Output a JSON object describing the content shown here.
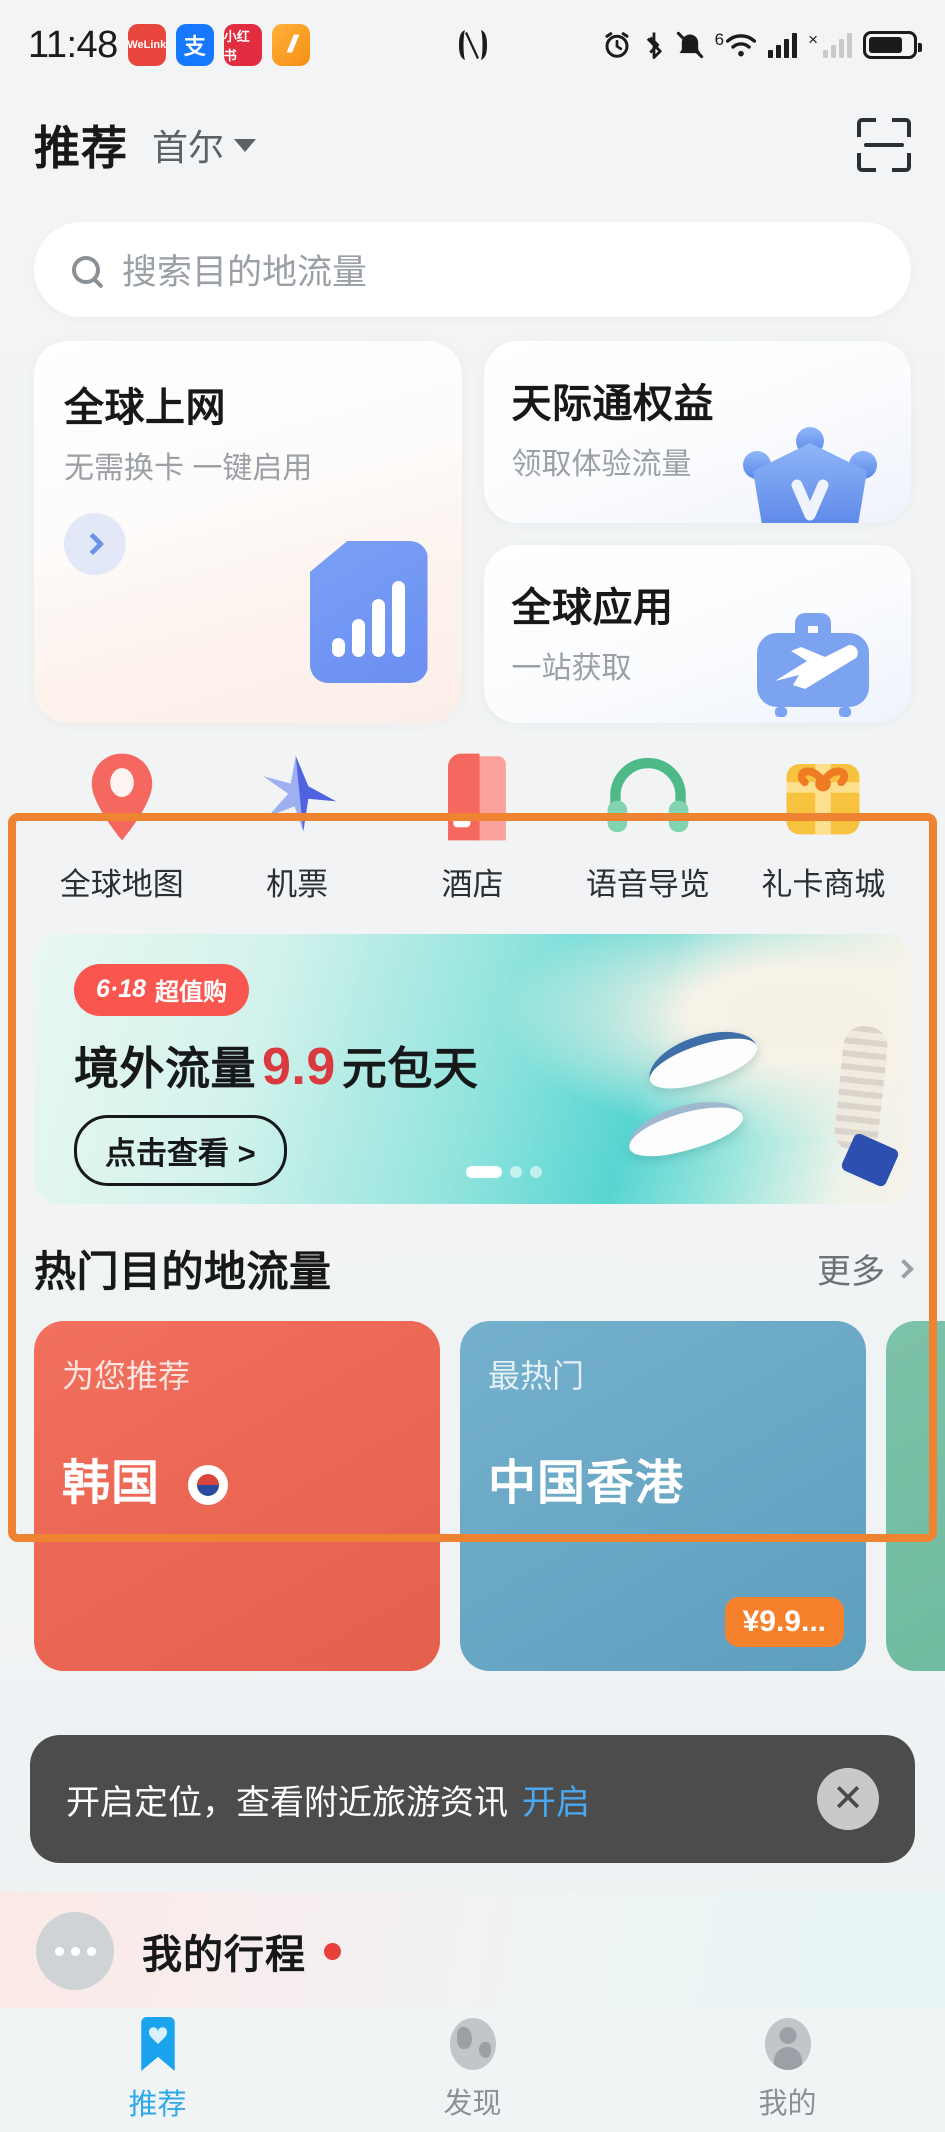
{
  "status_bar": {
    "time": "11:48",
    "apps": [
      {
        "name": "welink-app-icon",
        "label": "WeLink"
      },
      {
        "name": "alipay-app-icon",
        "label": "支"
      },
      {
        "name": "xiaohongshu-app-icon",
        "label": "小红书"
      },
      {
        "name": "orange-app-icon",
        "label": "//"
      }
    ],
    "nfc": "N",
    "network_gen": "6",
    "icons": [
      "nfc-icon",
      "alarm-icon",
      "bluetooth-icon",
      "mute-icon",
      "wifi-icon",
      "signal-icon",
      "signal-off-icon",
      "battery-icon"
    ]
  },
  "header": {
    "title": "推荐",
    "city": "首尔",
    "scan_icon": "scan-icon"
  },
  "search": {
    "placeholder": "搜索目的地流量"
  },
  "feature_cards": {
    "global_net": {
      "title": "全球上网",
      "subtitle": "无需换卡 一键启用",
      "icon": "sim-signal-icon"
    },
    "rights": {
      "title": "天际通权益",
      "subtitle": "领取体验流量",
      "icon": "crown-icon"
    },
    "apps": {
      "title": "全球应用",
      "subtitle": "一站获取",
      "icon": "luggage-plane-icon"
    }
  },
  "quick_actions": [
    {
      "label": "全球地图",
      "icon": "map-pin-icon",
      "color": "#f4685f"
    },
    {
      "label": "机票",
      "icon": "airplane-icon",
      "color": "#5468e8"
    },
    {
      "label": "酒店",
      "icon": "hotel-icon",
      "color": "#f4685f"
    },
    {
      "label": "语音导览",
      "icon": "headphones-icon",
      "color": "#4fb98a"
    },
    {
      "label": "礼卡商城",
      "icon": "gift-icon",
      "color": "#f5a623"
    }
  ],
  "promo": {
    "badge_date": "6·18",
    "badge_text": "超值购",
    "headline_prefix": "境外流量",
    "headline_price": "9.9",
    "headline_suffix": "元包天",
    "button": "点击查看 >",
    "slide_count": 3,
    "active_slide": 1
  },
  "popular_section": {
    "title": "热门目的地流量",
    "more": "更多",
    "destinations": [
      {
        "tag": "为您推荐",
        "name": "韩国",
        "flag": "korea-flag-icon",
        "price": ""
      },
      {
        "tag": "最热门",
        "name": "中国香港",
        "price": "¥9.9..."
      },
      {
        "tag": "",
        "name": "",
        "price": ""
      }
    ]
  },
  "location_toast": {
    "message": "开启定位，查看附近旅游资讯",
    "action": "开启",
    "close": "✕"
  },
  "my_trips": {
    "label": "我的行程",
    "has_badge": true,
    "menu_icon": "more-dots-icon"
  },
  "bottom_nav": [
    {
      "label": "推荐",
      "icon": "bookmark-heart-icon",
      "active": true
    },
    {
      "label": "发现",
      "icon": "globe-icon",
      "active": false
    },
    {
      "label": "我的",
      "icon": "person-icon",
      "active": false
    }
  ],
  "colors": {
    "accent_blue": "#2fa8e8",
    "highlight_orange": "#ee8331",
    "promo_red": "#d9393f",
    "badge_red": "#f8564e"
  }
}
